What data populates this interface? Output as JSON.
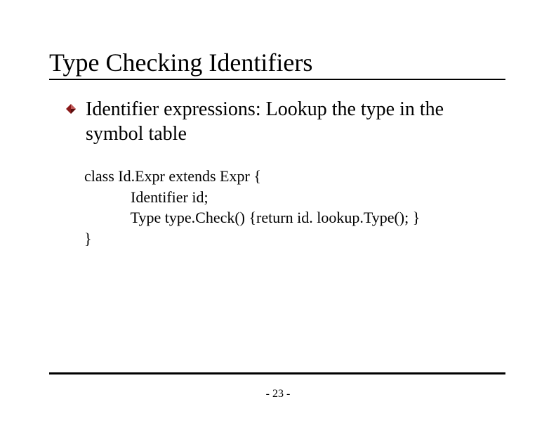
{
  "title": "Type Checking Identifiers",
  "bullet": "Identifier expressions: Lookup the type in the symbol table",
  "code": {
    "l1": "class Id.Expr extends Expr {",
    "l2": "            Identifier id;",
    "l3": "            Type type.Check() {return id. lookup.Type(); }",
    "l4": "}"
  },
  "page": "- 23 -"
}
